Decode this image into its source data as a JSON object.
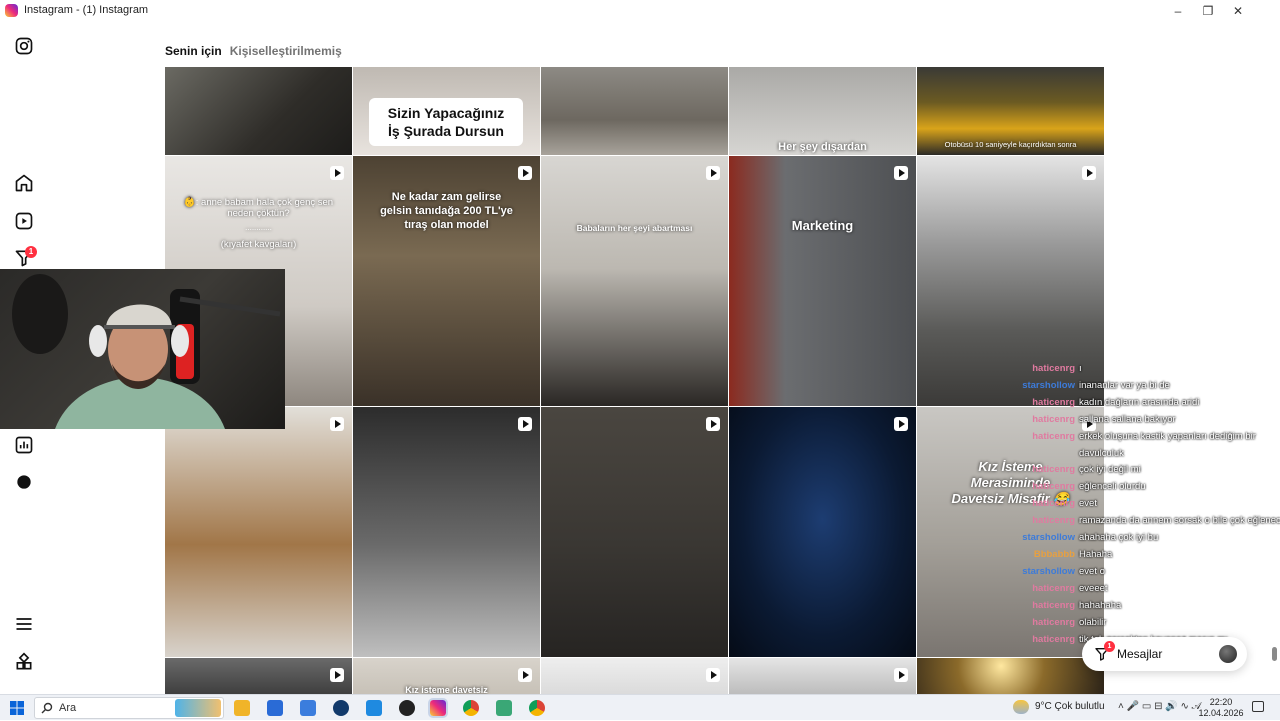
{
  "window": {
    "title": "Instagram - (1) Instagram",
    "minimize_glyph": "–",
    "maximize_glyph": "❐",
    "close_glyph": "✕"
  },
  "sidebar": {
    "notifications_badge": "1",
    "icons": [
      "instagram-icon",
      "home-icon",
      "reels-icon",
      "notifications-icon",
      "insights-icon",
      "profile-avatar",
      "menu-icon",
      "apps-icon"
    ]
  },
  "feed": {
    "tabs": [
      {
        "label": "Senin için",
        "active": true
      },
      {
        "label": "Kişiselleştirilmemiş",
        "active": false
      }
    ],
    "captions": {
      "r0c1": "Sizin Yapacağınız\nİş Şurada Dursun",
      "r0c3": "Her şey dışardan",
      "r0c4": "Otobüsü 10 saniyeyle kaçırdıktan sonra",
      "r1c0_line1": "👶: anne babam hala çok genç sen neden çöktün?",
      "r1c0_line2": "............",
      "r1c0_line3": "(kıyafet kavgaları)",
      "r1c1": "Ne kadar zam gelirse gelsin tanıdağa 200 TL'ye tıraş olan model",
      "r1c2": "Babaların her şeyi abartması",
      "r1c3": "Marketing",
      "r2c4": "Kız İsteme Merasiminde Davetsiz Misafir 😂",
      "r3c1": "Kız isteme davetsiz"
    }
  },
  "chat": [
    {
      "user": "haticenrg",
      "color": "#e07aa0",
      "msg": "ı"
    },
    {
      "user": "starshollow",
      "color": "#3d7bd9",
      "msg": "inananlar var ya bi de"
    },
    {
      "user": "haticenrg",
      "color": "#e07aa0",
      "msg": "kadın dağların arasında aridi"
    },
    {
      "user": "haticenrg",
      "color": "#e07aa0",
      "msg": "sallana sallana bakıyor"
    },
    {
      "user": "haticenrg",
      "color": "#e07aa0",
      "msg": "erkek oluşuna kastik yapanları dediğim bir"
    },
    {
      "user": "",
      "color": "#e07aa0",
      "msg": "davulculuk"
    },
    {
      "user": "haticenrg",
      "color": "#e07aa0",
      "msg": "çok iyi değil mi"
    },
    {
      "user": "haticenrg",
      "color": "#e07aa0",
      "msg": "eğlenceli olurdu"
    },
    {
      "user": "haticenrg",
      "color": "#e07aa0",
      "msg": "evet"
    },
    {
      "user": "haticenrg",
      "color": "#e07aa0",
      "msg": "ramazanda da annem sorsak o bile çok eğlenecek"
    },
    {
      "user": "starshollow",
      "color": "#3d7bd9",
      "msg": "ahahaha çok iyi bu"
    },
    {
      "user": "Bbbabbb",
      "color": "#e8a040",
      "msg": "Hahaha"
    },
    {
      "user": "starshollow",
      "color": "#3d7bd9",
      "msg": "evet o"
    },
    {
      "user": "haticenrg",
      "color": "#e07aa0",
      "msg": "eveeet"
    },
    {
      "user": "haticenrg",
      "color": "#e07aa0",
      "msg": "hahahaha"
    },
    {
      "user": "haticenrg",
      "color": "#e07aa0",
      "msg": "olabilir"
    },
    {
      "user": "haticenrg",
      "color": "#e07aa0",
      "msg": "tik tok gerçekten kavanoz maşın mı"
    }
  ],
  "messages": {
    "label": "Mesajlar",
    "badge": "1"
  },
  "taskbar": {
    "search_label": "Ara",
    "weather": "9°C  Çok bulutlu",
    "time": "22:20",
    "date": "12.04.2026"
  },
  "colors": {
    "instagram_badge": "#ff3040",
    "taskbar_bg": "#eef1f6"
  }
}
